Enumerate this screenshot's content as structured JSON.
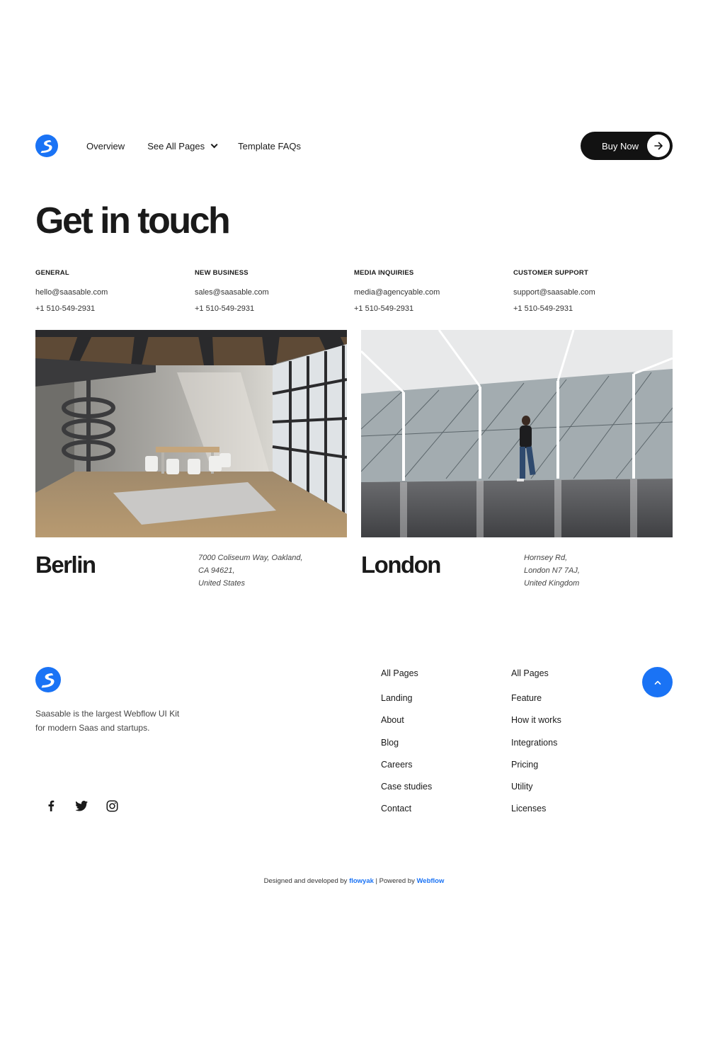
{
  "header": {
    "nav": [
      {
        "label": "Overview"
      },
      {
        "label": "See All Pages"
      },
      {
        "label": "Template FAQs"
      }
    ],
    "buy_button": "Buy Now"
  },
  "main": {
    "title": "Get in touch",
    "contacts": [
      {
        "category": "GENERAL",
        "email": "hello@saasable.com",
        "phone": "+1 510-549-2931"
      },
      {
        "category": "NEW BUSINESS",
        "email": "sales@saasable.com",
        "phone": "+1 510-549-2931"
      },
      {
        "category": "MEDIA INQUIRIES",
        "email": "media@agencyable.com",
        "phone": "+1 510-549-2931"
      },
      {
        "category": "CUSTOMER SUPPORT",
        "email": "support@saasable.com",
        "phone": "+1 510-549-2931"
      }
    ],
    "offices": [
      {
        "city": "Berlin",
        "address": [
          "7000 Coliseum Way, Oakland,",
          "CA 94621,",
          "United States"
        ]
      },
      {
        "city": "London",
        "address": [
          "Hornsey Rd,",
          "London N7 7AJ,",
          "United Kingdom"
        ]
      }
    ]
  },
  "footer": {
    "description": "Saasable is the largest Webflow UI Kit for modern Saas and startups.",
    "socials": [
      "facebook-icon",
      "twitter-icon",
      "instagram-icon"
    ],
    "columns": [
      {
        "heading": "All Pages",
        "links": [
          "Landing",
          "About",
          "Blog",
          "Careers",
          "Case studies",
          "Contact"
        ]
      },
      {
        "heading": "All Pages",
        "links": [
          "Feature",
          "How it works",
          "Integrations",
          "Pricing",
          "Utility",
          "Licenses"
        ]
      }
    ],
    "credits": {
      "prefix": "Designed and developed by ",
      "designer": "flowyak",
      "separator": " | Powered by ",
      "platform": "Webflow"
    }
  },
  "colors": {
    "accent": "#1a73f5",
    "dark": "#121212"
  }
}
